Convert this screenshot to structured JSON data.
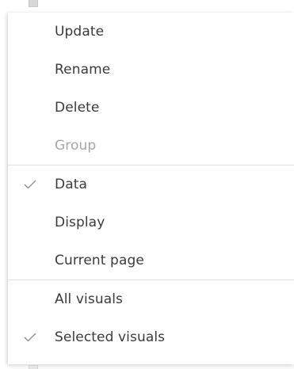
{
  "menu": {
    "group1": [
      {
        "label": "Update",
        "disabled": false
      },
      {
        "label": "Rename",
        "disabled": false
      },
      {
        "label": "Delete",
        "disabled": false
      },
      {
        "label": "Group",
        "disabled": true
      }
    ],
    "group2": [
      {
        "label": "Data",
        "checked": true
      },
      {
        "label": "Display",
        "checked": false
      },
      {
        "label": "Current page",
        "checked": false
      }
    ],
    "group3": [
      {
        "label": "All visuals",
        "checked": false
      },
      {
        "label": "Selected visuals",
        "checked": true
      }
    ]
  },
  "colors": {
    "text": "#3a3a3a",
    "disabled_text": "#a6a6a6",
    "check": "#8a8a8a",
    "separator": "#e1e1e1"
  },
  "icons": {
    "check": "checkmark-icon"
  }
}
